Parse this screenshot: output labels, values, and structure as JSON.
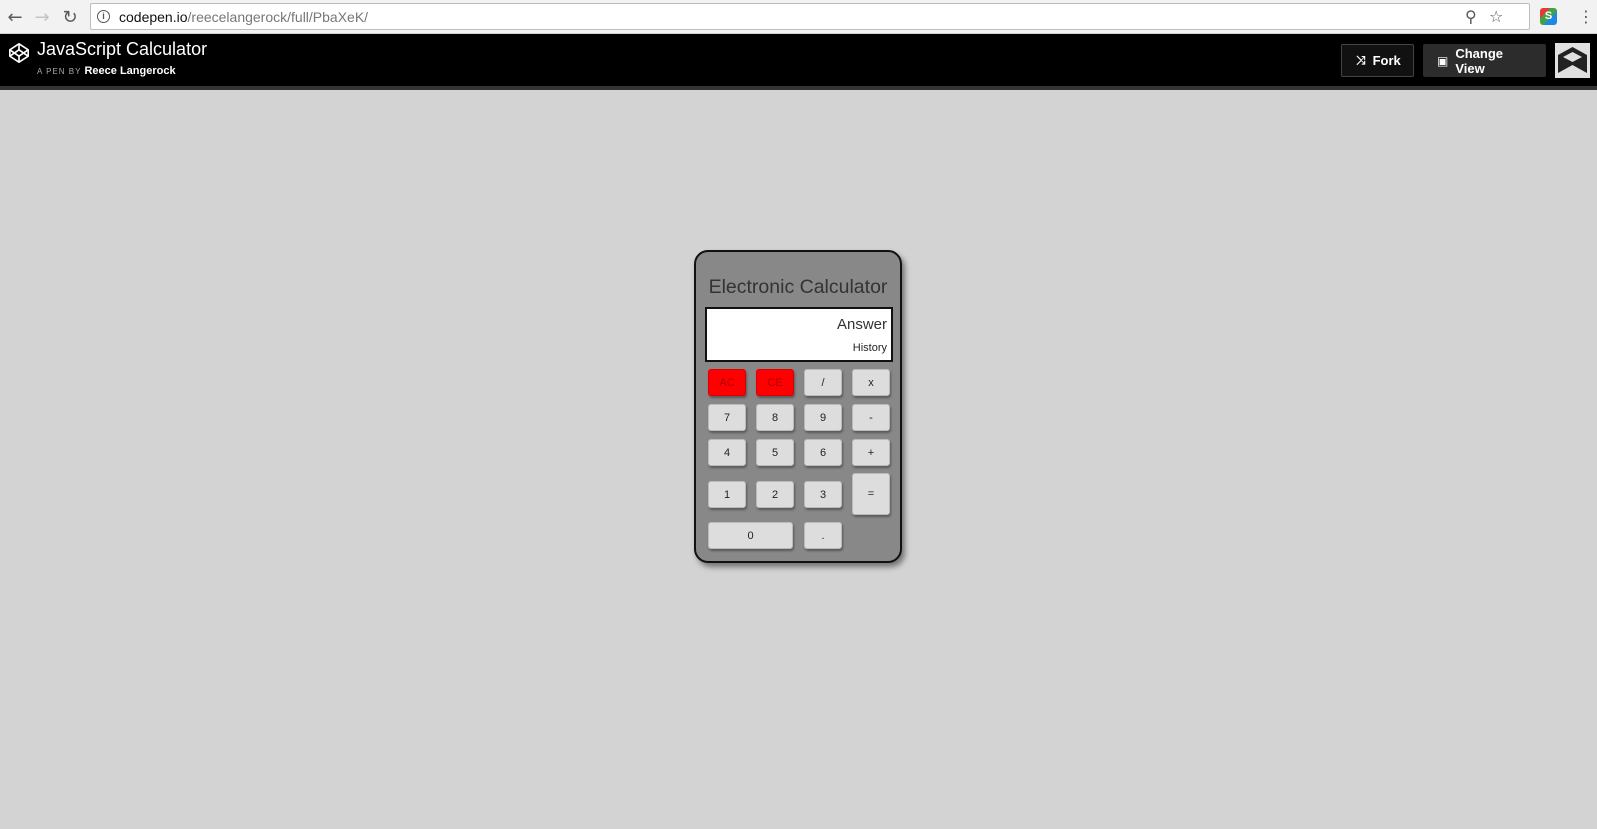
{
  "browser": {
    "url_host": "codepen.io",
    "url_path": "/reecelangerock/full/PbaXeK/",
    "icons": [
      "back-arrow-icon",
      "forward-arrow-icon",
      "reload-icon",
      "info-icon",
      "zoom-icon",
      "star-icon",
      "extension-icon",
      "menu-icon"
    ]
  },
  "header": {
    "title": "JavaScript Calculator",
    "byline": "A PEN BY",
    "author": "Reece Langerock",
    "fork_label": "Fork",
    "change_view_label": "Change View"
  },
  "calculator": {
    "title": "Electronic Calculator",
    "answer": "Answer",
    "history": "History",
    "keys": {
      "ac": "AC",
      "ce": "CE",
      "divide": "/",
      "multiply": "x",
      "seven": "7",
      "eight": "8",
      "nine": "9",
      "minus": "-",
      "four": "4",
      "five": "5",
      "six": "6",
      "plus": "+",
      "one": "1",
      "two": "2",
      "three": "3",
      "equals": "=",
      "zero": "0",
      "decimal": "."
    },
    "colors": {
      "clear_keys": "#ff0000",
      "body": "#888888",
      "page_background": "#d3d3d3"
    }
  }
}
